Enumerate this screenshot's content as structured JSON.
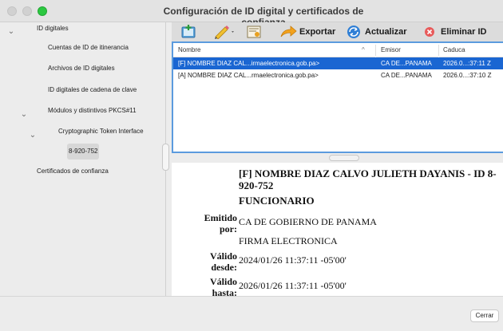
{
  "window": {
    "title": "Configuración de ID digital y certificados de confianza"
  },
  "sidebar": {
    "items": [
      {
        "label": "ID digitales",
        "expanded": true
      },
      {
        "label": "Cuentas de ID de itinerancia"
      },
      {
        "label": "Archivos de ID digitales"
      },
      {
        "label": "ID digitales de cadena de clave"
      },
      {
        "label": "Módulos y distintivos PKCS#11",
        "expanded": true
      },
      {
        "label": "Cryptographic Token Interface",
        "expanded": true
      },
      {
        "label": "8-920-752",
        "selected": true
      },
      {
        "label": "Certificados de confianza"
      }
    ]
  },
  "toolbar": {
    "export_label": "Exportar",
    "refresh_label": "Actualizar",
    "remove_label": "Eliminar ID"
  },
  "table": {
    "columns": [
      "Nombre",
      "Emisor",
      "Caduca"
    ],
    "rows": [
      {
        "name": "[F] NOMBRE DIAZ CAL...irmaelectronica.gob.pa>",
        "issuer": "CA DE...PANAMA",
        "expires": "2026.0...:37:11 Z",
        "selected": true
      },
      {
        "name": "[A] NOMBRE DIAZ CAL...rmaelectronica.gob.pa>",
        "issuer": "CA DE...PANAMA",
        "expires": "2026.0...:37:10 Z",
        "selected": false
      }
    ]
  },
  "detail": {
    "name": "[F] NOMBRE DIAZ CALVO JULIETH DAYANIS - ID 8-920-752",
    "role": "FUNCIONARIO",
    "issued_by_label": "Emitido por:",
    "issued_by_value": "CA DE GOBIERNO DE PANAMA",
    "issued_by_value2": "FIRMA ELECTRONICA",
    "valid_from_label": "Válido desde:",
    "valid_from_value": "2024/01/26 11:37:11 -05'00'",
    "valid_to_label": "Válido hasta:",
    "valid_to_value": "2026/01/26 11:37:11 -05'00'"
  },
  "footer": {
    "close_label": "Cerrar"
  },
  "colors": {
    "selection": "#1a66d2",
    "focus_ring": "#5b9bde",
    "zoom_light": "#2bc840"
  }
}
